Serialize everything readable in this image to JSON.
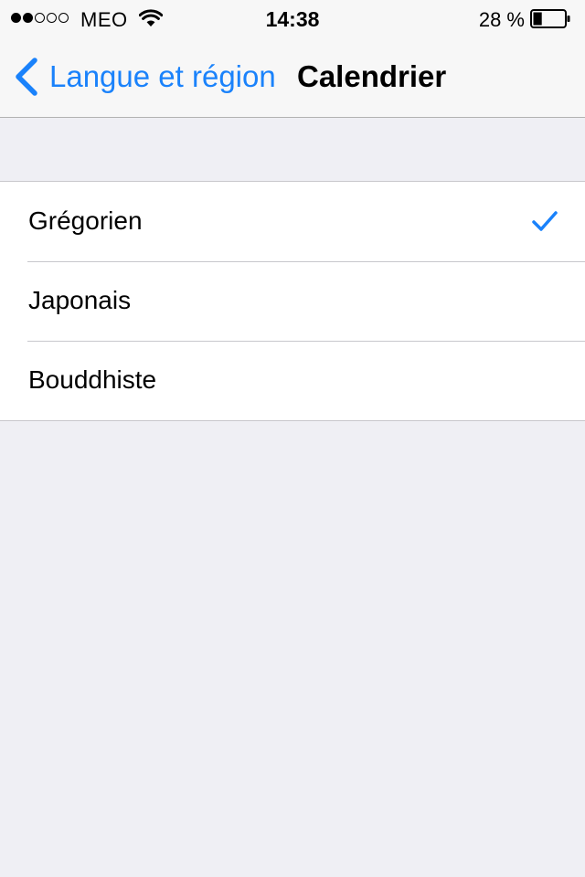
{
  "status_bar": {
    "signal_strength": 2,
    "signal_total": 5,
    "carrier": "MEO",
    "wifi_icon": "wifi-icon",
    "time": "14:38",
    "battery_percent": "28 %",
    "battery_level": 0.28
  },
  "nav": {
    "back_icon": "chevron-left-icon",
    "back_label": "Langue et région",
    "title": "Calendrier"
  },
  "calendar_options": [
    {
      "label": "Grégorien",
      "selected": true
    },
    {
      "label": "Japonais",
      "selected": false
    },
    {
      "label": "Bouddhiste",
      "selected": false
    }
  ],
  "colors": {
    "accent": "#1a82fb",
    "background": "#efeff4",
    "separator": "#c8c7cc"
  }
}
